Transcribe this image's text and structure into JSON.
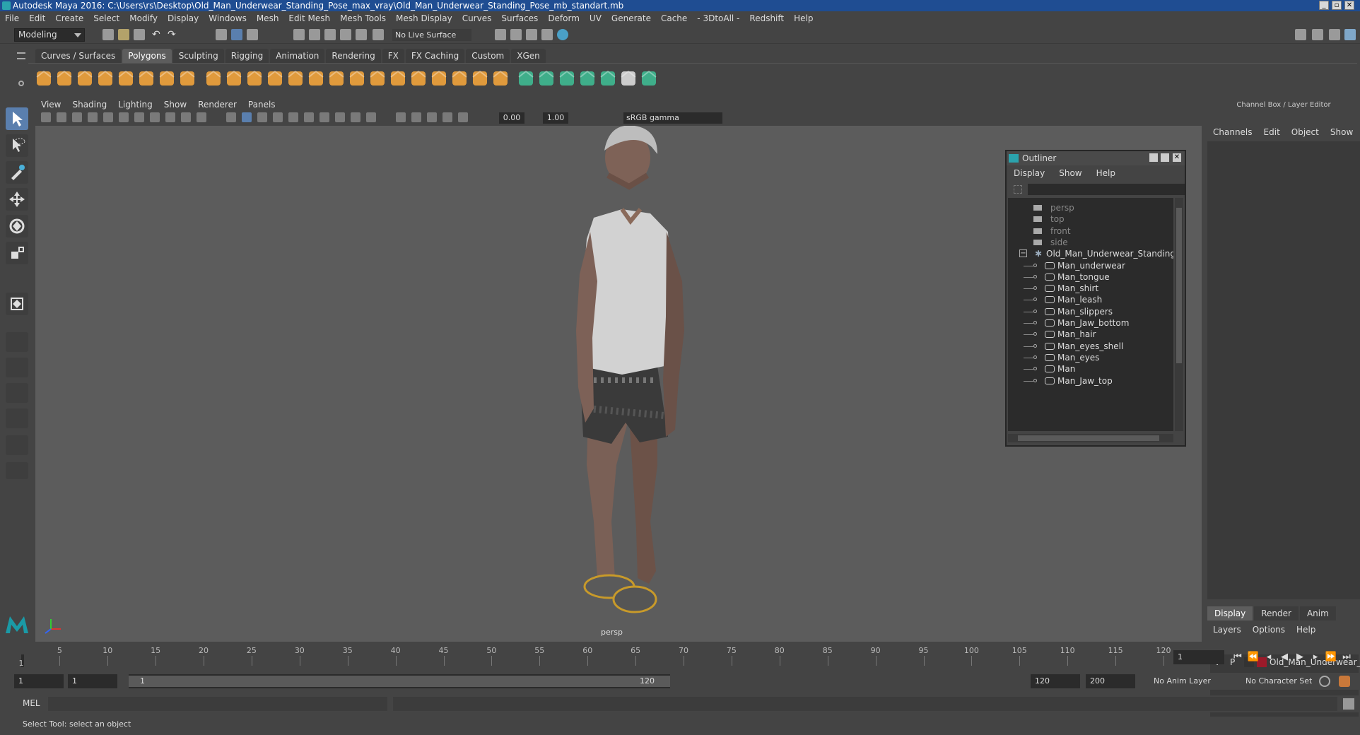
{
  "window": {
    "title": "Autodesk Maya 2016: C:\\Users\\rs\\Desktop\\Old_Man_Underwear_Standing_Pose_max_vray\\Old_Man_Underwear_Standing_Pose_mb_standart.mb"
  },
  "menubar": [
    "File",
    "Edit",
    "Create",
    "Select",
    "Modify",
    "Display",
    "Windows",
    "Mesh",
    "Edit Mesh",
    "Mesh Tools",
    "Mesh Display",
    "Curves",
    "Surfaces",
    "Deform",
    "UV",
    "Generate",
    "Cache",
    "- 3DtoAll -",
    "Redshift",
    "Help"
  ],
  "statusline": {
    "mode": "Modeling",
    "live_surface": "No Live Surface"
  },
  "shelf_tabs": [
    "Curves / Surfaces",
    "Polygons",
    "Sculpting",
    "Rigging",
    "Animation",
    "Rendering",
    "FX",
    "FX Caching",
    "Custom",
    "XGen"
  ],
  "shelf_active": "Polygons",
  "viewport": {
    "menu": [
      "View",
      "Shading",
      "Lighting",
      "Show",
      "Renderer",
      "Panels"
    ],
    "exposure": "0.00",
    "gamma": "1.00",
    "color_space": "sRGB gamma",
    "camera": "persp"
  },
  "outliner": {
    "title": "Outliner",
    "menu": [
      "Display",
      "Show",
      "Help"
    ],
    "cameras": [
      "persp",
      "top",
      "front",
      "side"
    ],
    "group": "Old_Man_Underwear_Standing_I",
    "children": [
      "Man_underwear",
      "Man_tongue",
      "Man_shirt",
      "Man_leash",
      "Man_slippers",
      "Man_Jaw_bottom",
      "Man_hair",
      "Man_eyes_shell",
      "Man_eyes",
      "Man",
      "Man_Jaw_top"
    ]
  },
  "channel_box": {
    "title": "Channel Box / Layer Editor",
    "menu": [
      "Channels",
      "Edit",
      "Object",
      "Show"
    ],
    "layer_tabs": [
      "Display",
      "Render",
      "Anim"
    ],
    "layer_menu": [
      "Layers",
      "Options",
      "Help"
    ],
    "layer": {
      "v": "V",
      "p": "P",
      "name": "Old_Man_Underwear_",
      "color": "#9b1a2a"
    }
  },
  "timeline": {
    "ticks": [
      "5",
      "10",
      "15",
      "20",
      "25",
      "30",
      "35",
      "40",
      "45",
      "50",
      "55",
      "60",
      "65",
      "70",
      "75",
      "80",
      "85",
      "90",
      "95",
      "100",
      "105",
      "110",
      "115",
      "120"
    ],
    "start_marker": "1",
    "current_frame": "1"
  },
  "range": {
    "start": "1",
    "playback_start": "1",
    "slider_start": "1",
    "slider_end": "120",
    "playback_end": "120",
    "end": "200",
    "anim_layer": "No Anim Layer",
    "char_set": "No Character Set"
  },
  "cmdline": {
    "label": "MEL"
  },
  "helpline": {
    "text": "Select Tool: select an object"
  }
}
